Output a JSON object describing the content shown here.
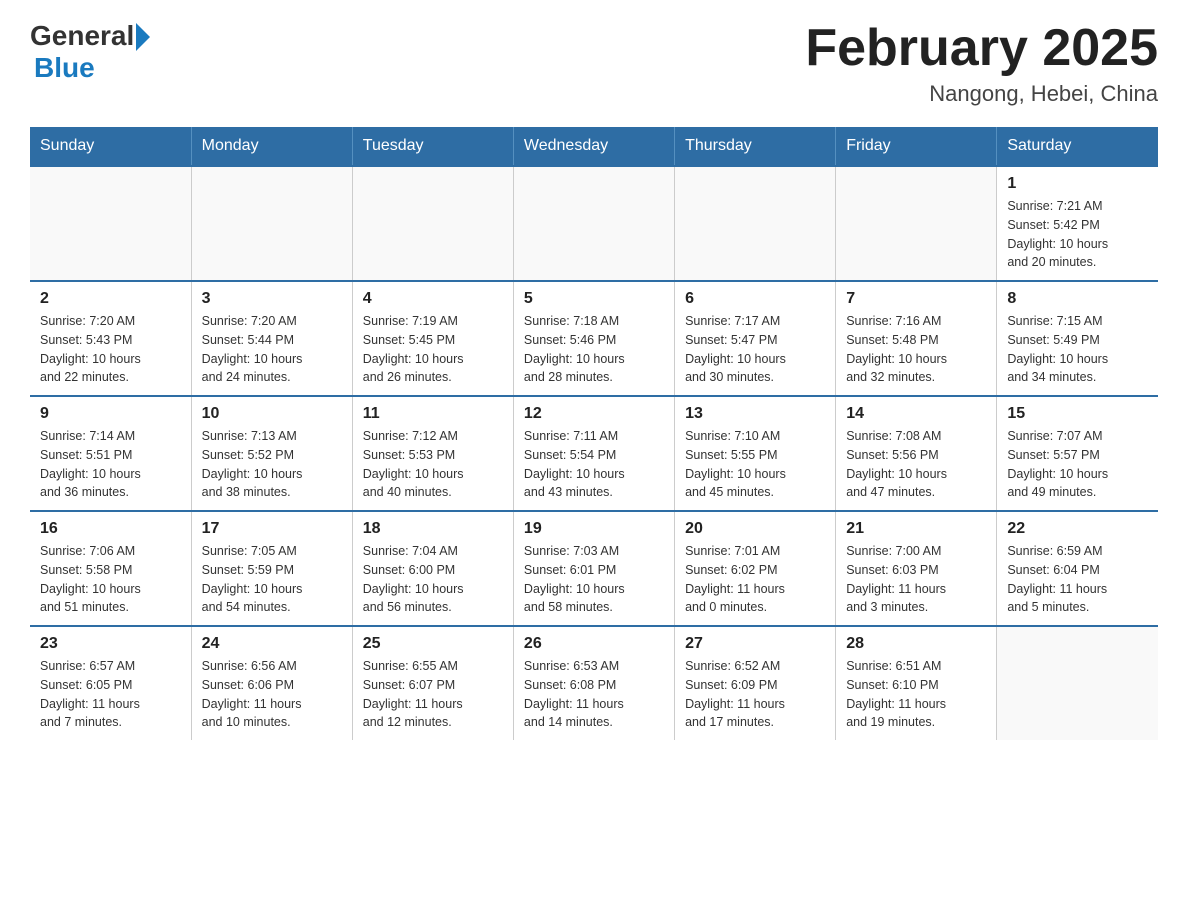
{
  "header": {
    "logo_general": "General",
    "logo_blue": "Blue",
    "month_title": "February 2025",
    "location": "Nangong, Hebei, China"
  },
  "days_of_week": [
    "Sunday",
    "Monday",
    "Tuesday",
    "Wednesday",
    "Thursday",
    "Friday",
    "Saturday"
  ],
  "weeks": [
    [
      {
        "day": "",
        "info": ""
      },
      {
        "day": "",
        "info": ""
      },
      {
        "day": "",
        "info": ""
      },
      {
        "day": "",
        "info": ""
      },
      {
        "day": "",
        "info": ""
      },
      {
        "day": "",
        "info": ""
      },
      {
        "day": "1",
        "info": "Sunrise: 7:21 AM\nSunset: 5:42 PM\nDaylight: 10 hours\nand 20 minutes."
      }
    ],
    [
      {
        "day": "2",
        "info": "Sunrise: 7:20 AM\nSunset: 5:43 PM\nDaylight: 10 hours\nand 22 minutes."
      },
      {
        "day": "3",
        "info": "Sunrise: 7:20 AM\nSunset: 5:44 PM\nDaylight: 10 hours\nand 24 minutes."
      },
      {
        "day": "4",
        "info": "Sunrise: 7:19 AM\nSunset: 5:45 PM\nDaylight: 10 hours\nand 26 minutes."
      },
      {
        "day": "5",
        "info": "Sunrise: 7:18 AM\nSunset: 5:46 PM\nDaylight: 10 hours\nand 28 minutes."
      },
      {
        "day": "6",
        "info": "Sunrise: 7:17 AM\nSunset: 5:47 PM\nDaylight: 10 hours\nand 30 minutes."
      },
      {
        "day": "7",
        "info": "Sunrise: 7:16 AM\nSunset: 5:48 PM\nDaylight: 10 hours\nand 32 minutes."
      },
      {
        "day": "8",
        "info": "Sunrise: 7:15 AM\nSunset: 5:49 PM\nDaylight: 10 hours\nand 34 minutes."
      }
    ],
    [
      {
        "day": "9",
        "info": "Sunrise: 7:14 AM\nSunset: 5:51 PM\nDaylight: 10 hours\nand 36 minutes."
      },
      {
        "day": "10",
        "info": "Sunrise: 7:13 AM\nSunset: 5:52 PM\nDaylight: 10 hours\nand 38 minutes."
      },
      {
        "day": "11",
        "info": "Sunrise: 7:12 AM\nSunset: 5:53 PM\nDaylight: 10 hours\nand 40 minutes."
      },
      {
        "day": "12",
        "info": "Sunrise: 7:11 AM\nSunset: 5:54 PM\nDaylight: 10 hours\nand 43 minutes."
      },
      {
        "day": "13",
        "info": "Sunrise: 7:10 AM\nSunset: 5:55 PM\nDaylight: 10 hours\nand 45 minutes."
      },
      {
        "day": "14",
        "info": "Sunrise: 7:08 AM\nSunset: 5:56 PM\nDaylight: 10 hours\nand 47 minutes."
      },
      {
        "day": "15",
        "info": "Sunrise: 7:07 AM\nSunset: 5:57 PM\nDaylight: 10 hours\nand 49 minutes."
      }
    ],
    [
      {
        "day": "16",
        "info": "Sunrise: 7:06 AM\nSunset: 5:58 PM\nDaylight: 10 hours\nand 51 minutes."
      },
      {
        "day": "17",
        "info": "Sunrise: 7:05 AM\nSunset: 5:59 PM\nDaylight: 10 hours\nand 54 minutes."
      },
      {
        "day": "18",
        "info": "Sunrise: 7:04 AM\nSunset: 6:00 PM\nDaylight: 10 hours\nand 56 minutes."
      },
      {
        "day": "19",
        "info": "Sunrise: 7:03 AM\nSunset: 6:01 PM\nDaylight: 10 hours\nand 58 minutes."
      },
      {
        "day": "20",
        "info": "Sunrise: 7:01 AM\nSunset: 6:02 PM\nDaylight: 11 hours\nand 0 minutes."
      },
      {
        "day": "21",
        "info": "Sunrise: 7:00 AM\nSunset: 6:03 PM\nDaylight: 11 hours\nand 3 minutes."
      },
      {
        "day": "22",
        "info": "Sunrise: 6:59 AM\nSunset: 6:04 PM\nDaylight: 11 hours\nand 5 minutes."
      }
    ],
    [
      {
        "day": "23",
        "info": "Sunrise: 6:57 AM\nSunset: 6:05 PM\nDaylight: 11 hours\nand 7 minutes."
      },
      {
        "day": "24",
        "info": "Sunrise: 6:56 AM\nSunset: 6:06 PM\nDaylight: 11 hours\nand 10 minutes."
      },
      {
        "day": "25",
        "info": "Sunrise: 6:55 AM\nSunset: 6:07 PM\nDaylight: 11 hours\nand 12 minutes."
      },
      {
        "day": "26",
        "info": "Sunrise: 6:53 AM\nSunset: 6:08 PM\nDaylight: 11 hours\nand 14 minutes."
      },
      {
        "day": "27",
        "info": "Sunrise: 6:52 AM\nSunset: 6:09 PM\nDaylight: 11 hours\nand 17 minutes."
      },
      {
        "day": "28",
        "info": "Sunrise: 6:51 AM\nSunset: 6:10 PM\nDaylight: 11 hours\nand 19 minutes."
      },
      {
        "day": "",
        "info": ""
      }
    ]
  ]
}
